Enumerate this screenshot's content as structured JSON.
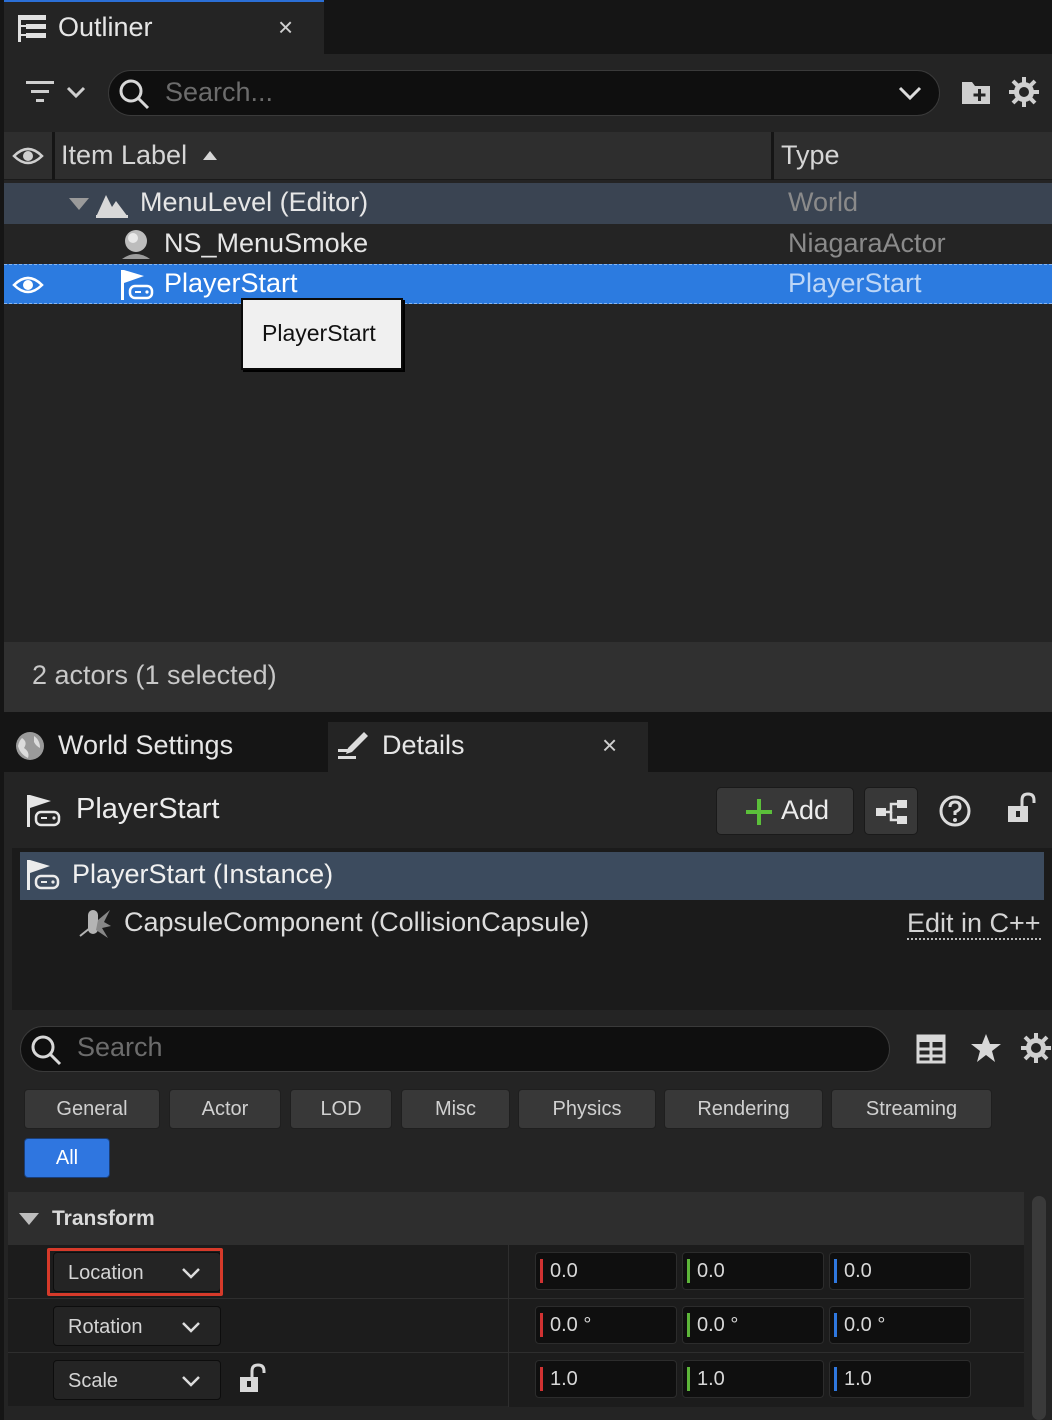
{
  "outliner": {
    "tab_title": "Outliner",
    "close": "×",
    "search_placeholder": "Search...",
    "columns": {
      "label": "Item Label",
      "type": "Type"
    },
    "rows": [
      {
        "label": "MenuLevel (Editor)",
        "type": "World",
        "icon": "world-mountain-icon"
      },
      {
        "label": "NS_MenuSmoke",
        "type": "NiagaraActor",
        "icon": "niagara-actor-icon"
      },
      {
        "label": "PlayerStart",
        "type": "PlayerStart",
        "icon": "player-start-flag-icon"
      }
    ],
    "tooltip": "PlayerStart",
    "status": "2 actors (1 selected)"
  },
  "world_settings": {
    "tab_title": "World Settings",
    "icon": "globe-icon"
  },
  "details": {
    "tab_title": "Details",
    "close": "×",
    "actor_name": "PlayerStart",
    "add_label": "Add",
    "components": {
      "instance": "PlayerStart (Instance)",
      "capsule": "CapsuleComponent (CollisionCapsule)",
      "edit_cpp": "Edit in C++"
    },
    "search_placeholder": "Search",
    "filters": [
      "General",
      "Actor",
      "LOD",
      "Misc",
      "Physics",
      "Rendering",
      "Streaming"
    ],
    "filter_all": "All",
    "transform": {
      "title": "Transform",
      "location": {
        "label": "Location",
        "x": "0.0",
        "y": "0.0",
        "z": "0.0"
      },
      "rotation": {
        "label": "Rotation",
        "x": "0.0 °",
        "y": "0.0 °",
        "z": "0.0 °"
      },
      "scale": {
        "label": "Scale",
        "x": "1.0",
        "y": "1.0",
        "z": "1.0"
      }
    }
  },
  "colors": {
    "selection": "#2c7be0",
    "axis_x": "#d13232",
    "axis_y": "#5db53a",
    "axis_z": "#2f78e0",
    "highlight_outline": "#d63a2a"
  }
}
